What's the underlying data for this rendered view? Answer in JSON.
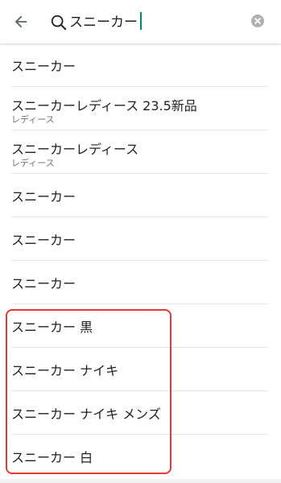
{
  "search": {
    "query": "スニーカー",
    "back_icon": "arrow-left-icon",
    "search_icon": "magnifier-icon",
    "clear_icon": "clear-icon"
  },
  "suggestions": [
    {
      "label": "スニーカー",
      "sub": ""
    },
    {
      "label": "スニーカーレディース 23.5新品",
      "sub": "レディース"
    },
    {
      "label": "スニーカーレディース",
      "sub": "レディース"
    },
    {
      "label": "スニーカー",
      "sub": ""
    },
    {
      "label": "スニーカー",
      "sub": ""
    },
    {
      "label": "スニーカー",
      "sub": ""
    },
    {
      "label": "スニーカー 黒",
      "sub": ""
    },
    {
      "label": "スニーカー ナイキ",
      "sub": ""
    },
    {
      "label": "スニーカー ナイキ メンズ",
      "sub": ""
    },
    {
      "label": "スニーカー 白",
      "sub": ""
    }
  ],
  "colors": {
    "caret": "#00897b",
    "highlight_border": "#e53935",
    "divider": "#e6e6e6"
  }
}
